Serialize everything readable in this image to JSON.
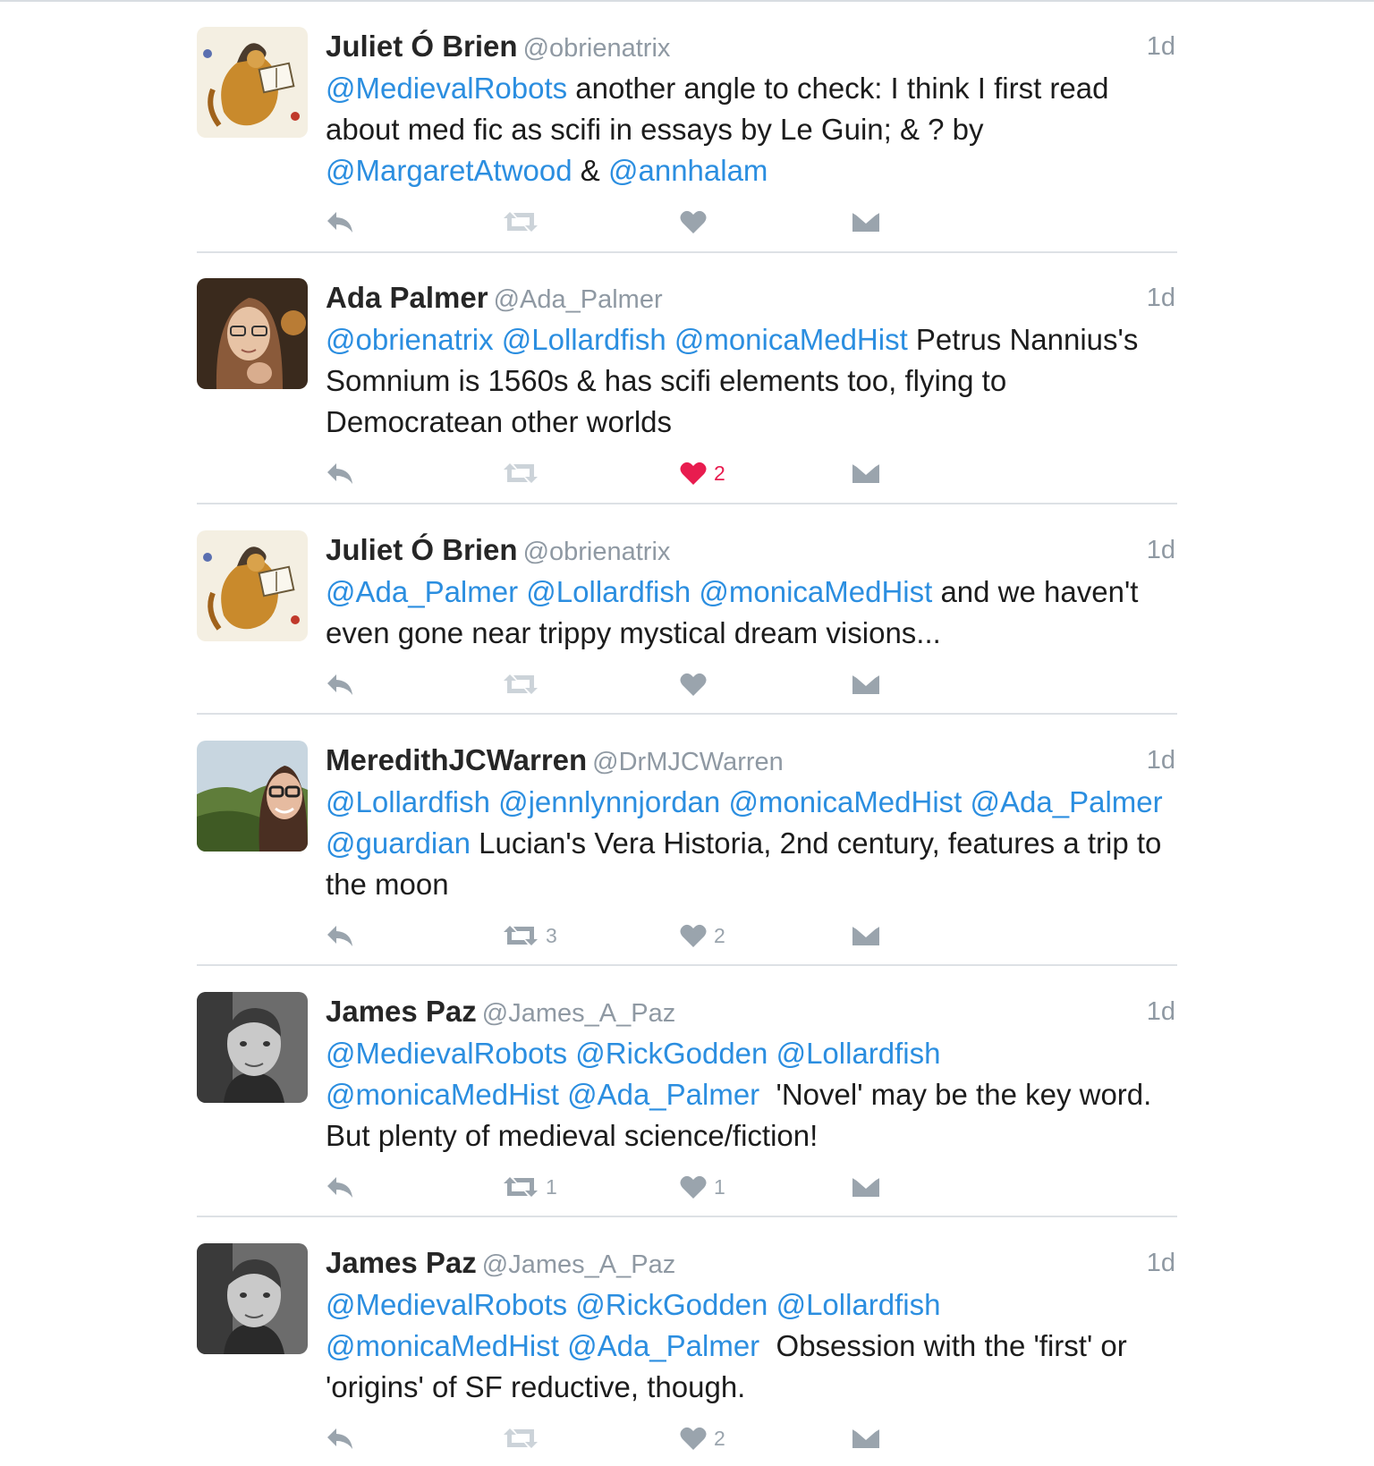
{
  "tweets": [
    {
      "name": "Juliet Ó Brien",
      "handle": "@obrienatrix",
      "time": "1d",
      "avatar": "illuminated-manuscript-avatar",
      "segments": [
        {
          "t": "@MedievalRobots",
          "m": true
        },
        {
          "t": " another angle to check: I think I first read about med fic as scifi in essays by Le Guin; & ? by "
        },
        {
          "t": "@MargaretAtwood",
          "m": true
        },
        {
          "t": " & "
        },
        {
          "t": "@annhalam",
          "m": true
        }
      ],
      "retweets": "",
      "likes": "",
      "liked": false
    },
    {
      "name": "Ada Palmer",
      "handle": "@Ada_Palmer",
      "time": "1d",
      "avatar": "woman-glasses-avatar",
      "segments": [
        {
          "t": "@obrienatrix",
          "m": true
        },
        {
          "t": " "
        },
        {
          "t": "@Lollardfish",
          "m": true
        },
        {
          "t": " "
        },
        {
          "t": "@monicaMedHist",
          "m": true
        },
        {
          "t": " Petrus Nannius's Somnium is 1560s & has scifi elements too, flying to Democratean other worlds"
        }
      ],
      "retweets": "",
      "likes": "2",
      "liked": true
    },
    {
      "name": "Juliet Ó Brien",
      "handle": "@obrienatrix",
      "time": "1d",
      "avatar": "illuminated-manuscript-avatar",
      "segments": [
        {
          "t": "@Ada_Palmer",
          "m": true
        },
        {
          "t": " "
        },
        {
          "t": "@Lollardfish",
          "m": true
        },
        {
          "t": " "
        },
        {
          "t": "@monicaMedHist",
          "m": true
        },
        {
          "t": " and we haven't even gone near trippy mystical dream visions..."
        }
      ],
      "retweets": "",
      "likes": "",
      "liked": false
    },
    {
      "name": "MeredithJCWarren",
      "handle": "@DrMJCWarren",
      "time": "1d",
      "avatar": "woman-landscape-avatar",
      "segments": [
        {
          "t": "@Lollardfish",
          "m": true
        },
        {
          "t": " "
        },
        {
          "t": "@jennlynnjordan",
          "m": true
        },
        {
          "t": " "
        },
        {
          "t": "@monicaMedHist",
          "m": true
        },
        {
          "t": " "
        },
        {
          "t": "@Ada_Palmer",
          "m": true
        },
        {
          "t": " "
        },
        {
          "t": "@guardian",
          "m": true
        },
        {
          "t": " Lucian's Vera Historia, 2nd century, features a trip to the moon"
        }
      ],
      "retweets": "3",
      "likes": "2",
      "liked": false
    },
    {
      "name": "James Paz",
      "handle": "@James_A_Paz",
      "time": "1d",
      "avatar": "man-bw-avatar",
      "segments": [
        {
          "t": "@MedievalRobots",
          "m": true
        },
        {
          "t": " "
        },
        {
          "t": "@RickGodden",
          "m": true
        },
        {
          "t": " "
        },
        {
          "t": "@Lollardfish",
          "m": true
        },
        {
          "t": " "
        },
        {
          "t": "@monicaMedHist",
          "m": true
        },
        {
          "t": " "
        },
        {
          "t": "@Ada_Palmer",
          "m": true
        },
        {
          "t": "  'Novel' may be the key word. But plenty of medieval science/fiction!"
        }
      ],
      "retweets": "1",
      "likes": "1",
      "liked": false
    },
    {
      "name": "James Paz",
      "handle": "@James_A_Paz",
      "time": "1d",
      "avatar": "man-bw-avatar",
      "segments": [
        {
          "t": "@MedievalRobots",
          "m": true
        },
        {
          "t": " "
        },
        {
          "t": "@RickGodden",
          "m": true
        },
        {
          "t": " "
        },
        {
          "t": "@Lollardfish",
          "m": true
        },
        {
          "t": " "
        },
        {
          "t": "@monicaMedHist",
          "m": true
        },
        {
          "t": " "
        },
        {
          "t": "@Ada_Palmer",
          "m": true
        },
        {
          "t": "  Obsession with the 'first' or 'origins' of SF reductive, though."
        }
      ],
      "retweets": "",
      "likes": "2",
      "liked": false
    }
  ],
  "colors": {
    "mention": "#2b8ee0",
    "liked": "#e81c4f",
    "icon": "#9aa4ad",
    "text": "#1c1c1c",
    "handle": "#8f99a3"
  }
}
